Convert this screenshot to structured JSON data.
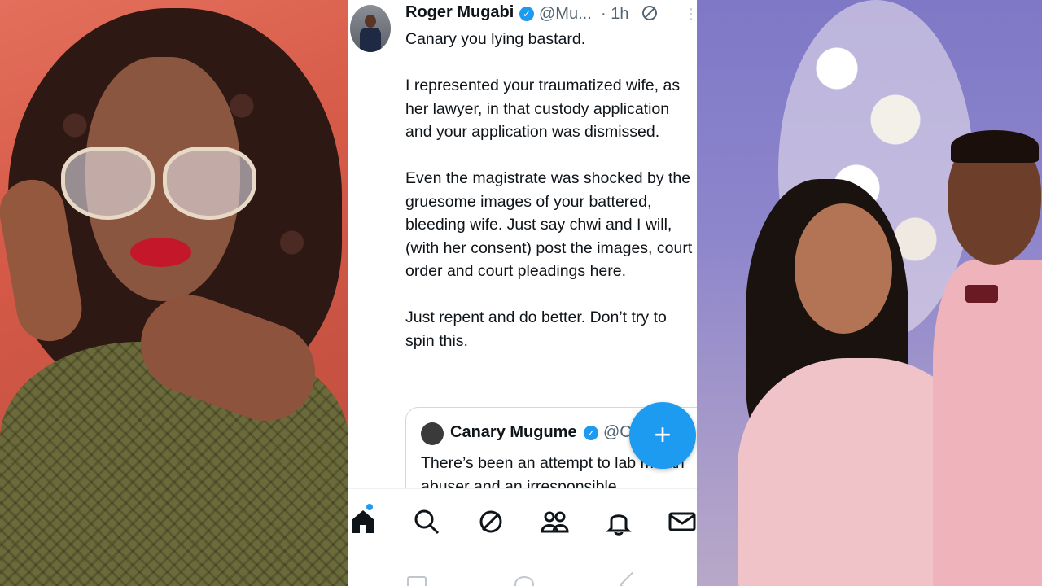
{
  "tweet": {
    "author_name": "Roger Mugabi",
    "author_handle": "@Mu...",
    "time": "· 1h",
    "paragraphs": [
      "Canary you lying bastard.",
      "I represented your traumatized wife, as her lawyer, in that custody application and your application was dismissed.",
      "Even the magistrate was shocked by the gruesome images of your battered, bleeding wife. Just say chwi and I will, (with her consent) post the images, court order and court pleadings here.",
      "Just repent and do better. Don’t try to spin this."
    ]
  },
  "quoted_tweet": {
    "author_name": "Canary Mugume",
    "author_handle": "@C",
    "text": "There’s been an attempt to lab me an abuser and an irresponsible"
  },
  "fab": {
    "label": "+"
  },
  "nav": {
    "items": [
      "home-icon",
      "search-icon",
      "spaces-icon",
      "communities-icon",
      "notifications-icon",
      "messages-icon"
    ]
  },
  "colors": {
    "accent": "#1d9bf0",
    "text": "#0f1419",
    "muted": "#536471"
  }
}
